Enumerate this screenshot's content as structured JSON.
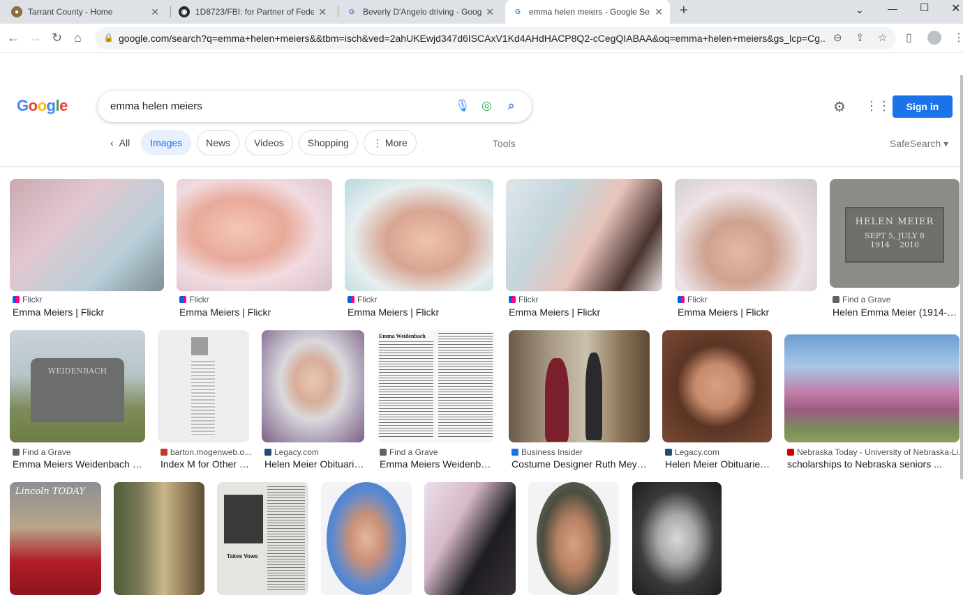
{
  "browser": {
    "tabs": [
      {
        "title": "Tarrant County - Home"
      },
      {
        "title": "1D8723/FBI: for Partner of Feder"
      },
      {
        "title": "Beverly D'Angelo driving - Goog"
      },
      {
        "title": "emma helen meiers - Google Se"
      }
    ],
    "url": "google.com/search?q=emma+helen+meiers&&tbm=isch&ved=2ahUKEwjd347d6ISCAxV1Kd4AHdHACP8Q2-cCegQIABAA&oq=emma+helen+meiers&gs_lcp=Cg..."
  },
  "google": {
    "logo": "Google",
    "query": "emma helen meiers",
    "signin": "Sign in",
    "chips": {
      "all": "All",
      "images": "Images",
      "news": "News",
      "videos": "Videos",
      "shopping": "Shopping",
      "more": "More"
    },
    "tools": "Tools",
    "safesearch": "SafeSearch"
  },
  "results": [
    {
      "source": "Flickr",
      "title": "Emma Meiers | Flickr"
    },
    {
      "source": "Flickr",
      "title": "Emma Meiers | Flickr"
    },
    {
      "source": "Flickr",
      "title": "Emma Meiers | Flickr"
    },
    {
      "source": "Flickr",
      "title": "Emma Meiers | Flickr"
    },
    {
      "source": "Flickr",
      "title": "Emma Meiers | Flickr"
    },
    {
      "source": "Find a Grave",
      "title": "Helen Emma Meier (1914-20..."
    },
    {
      "source": "Find a Grave",
      "title": "Emma Meiers Weidenbach (18..."
    },
    {
      "source": "barton.mogenweb.o...",
      "title": "Index M for Other O..."
    },
    {
      "source": "Legacy.com",
      "title": "Helen Meier Obituaries..."
    },
    {
      "source": "Find a Grave",
      "title": "Emma Meiers Weidenbach..."
    },
    {
      "source": "Business Insider",
      "title": "Costume Designer Ruth Meyers ..."
    },
    {
      "source": "Legacy.com",
      "title": "Helen Meier Obituaries ..."
    },
    {
      "source": "Nebraska Today - University of Nebraska-Li...",
      "title": "scholarships to Nebraska seniors ..."
    }
  ],
  "gravestone": {
    "name": "HELEN MEIER",
    "dates": "SEPT 5, JULY 8",
    "years": "1914    2010"
  },
  "headstone2": {
    "name": "WEIDENBACH"
  },
  "doc": {
    "heading": "Emma Weidenbach"
  },
  "newsclip": {
    "label": "Takes Vows"
  },
  "magazine": {
    "label": "Lincoln TODAY"
  }
}
